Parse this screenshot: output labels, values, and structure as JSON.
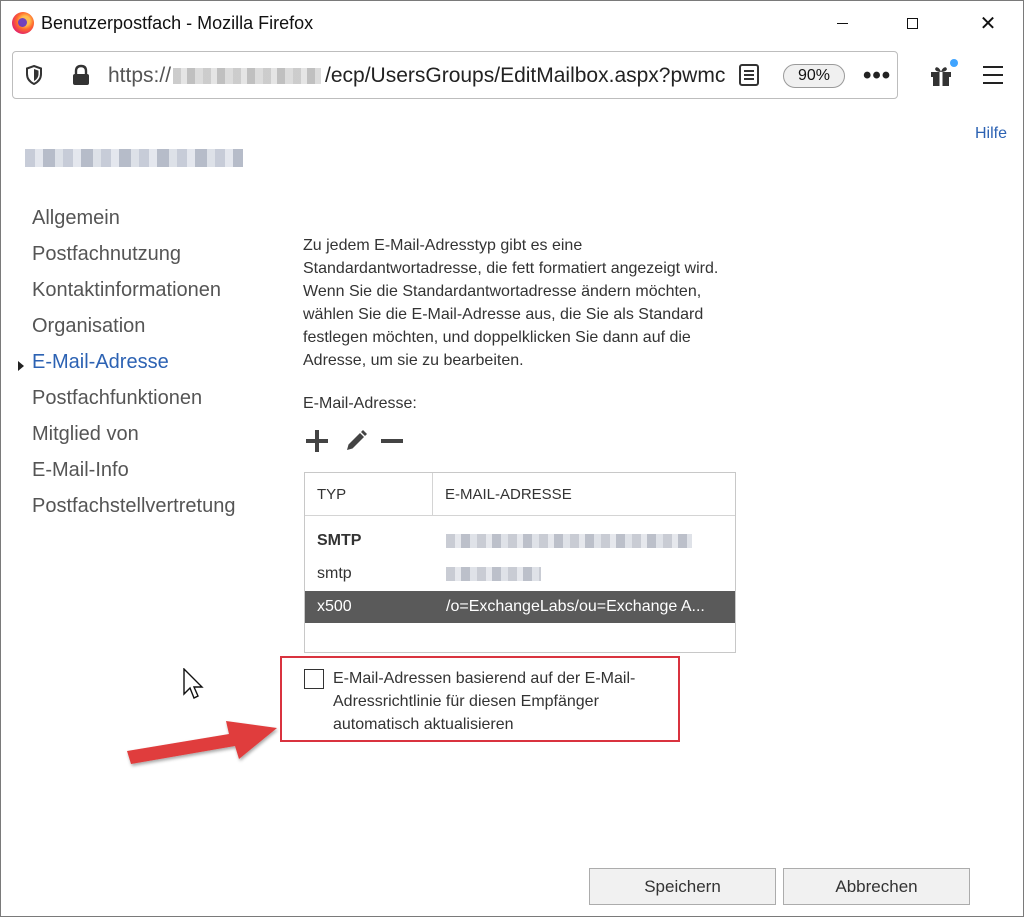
{
  "window": {
    "title": "Benutzerpostfach - Mozilla Firefox"
  },
  "urlbar": {
    "prefix": "https://",
    "path": "/ecp/UsersGroups/EditMailbox.aspx?pwmc",
    "zoom": "90%"
  },
  "help": "Hilfe",
  "nav": {
    "items": [
      {
        "label": "Allgemein"
      },
      {
        "label": "Postfachnutzung"
      },
      {
        "label": "Kontaktinformationen"
      },
      {
        "label": "Organisation"
      },
      {
        "label": "E-Mail-Adresse"
      },
      {
        "label": "Postfachfunktionen"
      },
      {
        "label": "Mitglied von"
      },
      {
        "label": "E-Mail-Info"
      },
      {
        "label": "Postfachstellvertretung"
      }
    ],
    "active_index": 4
  },
  "main": {
    "description": "Zu jedem E-Mail-Adresstyp gibt es eine Standardantwortadresse, die fett formatiert angezeigt wird. Wenn Sie die Standardantwortadresse ändern möchten, wählen Sie die E-Mail-Adresse aus, die Sie als Standard festlegen möchten, und doppelklicken Sie dann auf die Adresse, um sie zu bearbeiten.",
    "list_label": "E-Mail-Adresse:",
    "table": {
      "headers": [
        "TYP",
        "E-MAIL-ADRESSE"
      ],
      "rows": [
        {
          "type": "SMTP",
          "address": ""
        },
        {
          "type": "smtp",
          "address": ""
        },
        {
          "type": "x500",
          "address": "/o=ExchangeLabs/ou=Exchange A..."
        }
      ]
    },
    "checkbox_label": "E-Mail-Adressen basierend auf der E-Mail-Adressrichtlinie für diesen Empfänger automatisch aktualisieren",
    "checkbox_checked": false
  },
  "buttons": {
    "save": "Speichern",
    "cancel": "Abbrechen"
  },
  "colors": {
    "accent": "#2c62b3",
    "highlight_border": "#d9333f",
    "arrow": "#e03c3c",
    "selected_row": "#5a5a5a"
  }
}
